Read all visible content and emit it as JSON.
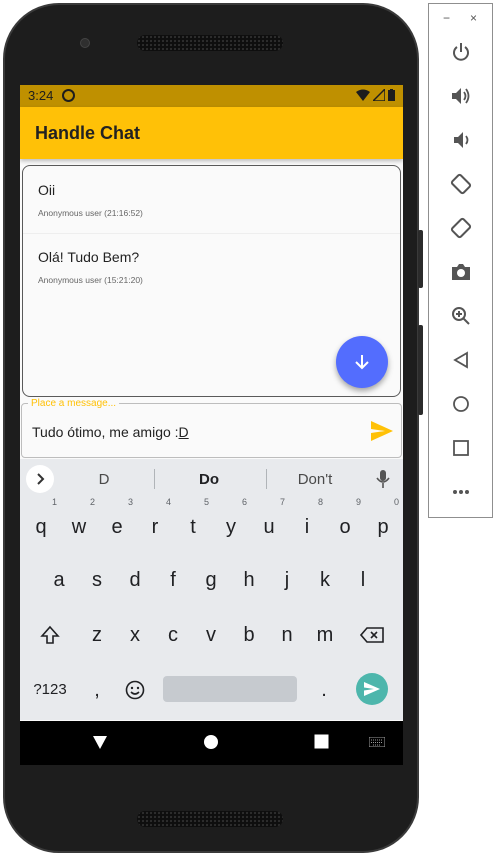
{
  "status_bar": {
    "time": "3:24",
    "icons": [
      "sync-icon",
      "wifi-icon",
      "signal-icon",
      "battery-icon"
    ]
  },
  "app_bar": {
    "title": "Handle Chat",
    "color": "#ffc107"
  },
  "messages": [
    {
      "text": "Oii",
      "meta": "Anonymous user (21:16:52)"
    },
    {
      "text": "Olá! Tudo Bem?",
      "meta": "Anonymous user (15:21:20)"
    }
  ],
  "scroll_fab": {
    "icon": "arrow-down-icon",
    "color": "#536dfe"
  },
  "message_input": {
    "label": "Place a message...",
    "value_prefix": "Tudo ótimo, me amigo :",
    "value_underlined": "D",
    "send_icon": "send-icon"
  },
  "keyboard": {
    "suggestions": [
      "D",
      "Do",
      "Don't"
    ],
    "row1": [
      "q",
      "w",
      "e",
      "r",
      "t",
      "y",
      "u",
      "i",
      "o",
      "p"
    ],
    "row1_hints": [
      "1",
      "2",
      "3",
      "4",
      "5",
      "6",
      "7",
      "8",
      "9",
      "0"
    ],
    "row2": [
      "a",
      "s",
      "d",
      "f",
      "g",
      "h",
      "j",
      "k",
      "l"
    ],
    "row3": [
      "z",
      "x",
      "c",
      "v",
      "b",
      "n",
      "m"
    ],
    "symbols_key": "?123",
    "comma": ",",
    "period": "."
  },
  "nav_bar": {
    "buttons": [
      "back-icon",
      "home-icon",
      "recents-icon",
      "keyboard-icon"
    ]
  },
  "emulator_panel": {
    "buttons": [
      "power-icon",
      "volume-up-icon",
      "volume-down-icon",
      "rotate-left-icon",
      "rotate-right-icon",
      "camera-icon",
      "zoom-icon",
      "back-icon",
      "home-icon",
      "overview-icon",
      "more-icon"
    ],
    "window_controls": [
      "−",
      "×"
    ]
  }
}
